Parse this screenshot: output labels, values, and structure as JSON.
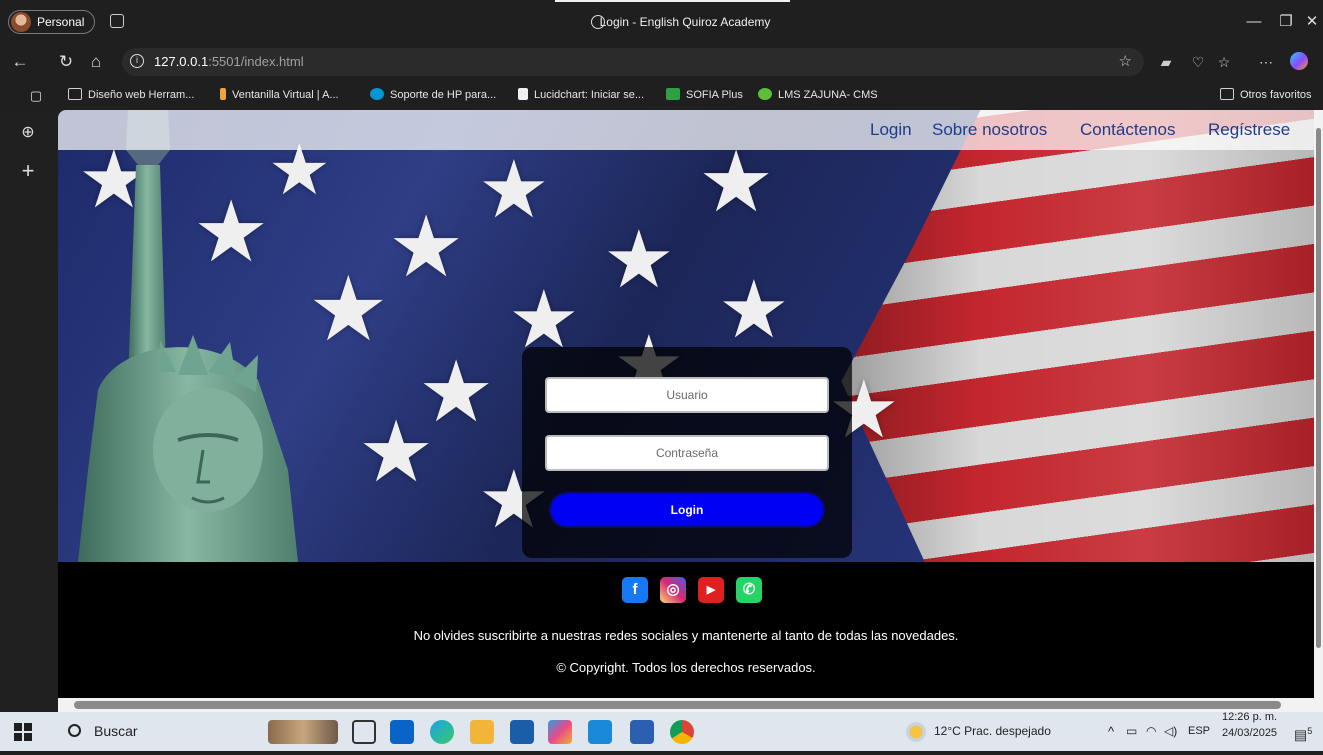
{
  "browser": {
    "profile_label": "Personal",
    "tab_title": "Login - English Quiroz Academy",
    "url_host": "127.0.0.1",
    "url_rest": ":5501/index.html",
    "favorites": [
      {
        "label": "Diseño web Herram...",
        "color": "#cfcfcf"
      },
      {
        "label": "Ventanilla Virtual | A...",
        "color": "#f2a33a"
      },
      {
        "label": "Soporte de HP para...",
        "color": "#0096d6"
      },
      {
        "label": "Lucidchart: Iniciar se...",
        "color": "#f0f0f0"
      },
      {
        "label": "SOFIA Plus",
        "color": "#2ea043"
      },
      {
        "label": "LMS ZAJUNA- CMS",
        "color": "#5bbf3a"
      }
    ],
    "other_favorites": "Otros favoritos"
  },
  "nav": {
    "links": [
      "Login",
      "Sobre nosotros",
      "Contáctenos",
      "Regístrese"
    ],
    "color": "#1d3c8a"
  },
  "login": {
    "username_placeholder": "Usuario",
    "password_placeholder": "Contraseña",
    "button_label": "Login",
    "button_color": "#0000f2"
  },
  "footer": {
    "social_icons": [
      {
        "name": "facebook-icon",
        "color": "#1877f2",
        "glyph": "f"
      },
      {
        "name": "instagram-icon",
        "color": "#d6249f",
        "glyph": "◎"
      },
      {
        "name": "youtube-icon",
        "color": "#e02020",
        "glyph": "▶"
      },
      {
        "name": "whatsapp-icon",
        "color": "#25d366",
        "glyph": "✆"
      }
    ],
    "subscribe_text": "No olvides suscribirte a nuestras redes sociales y mantenerte al tanto de todas las novedades.",
    "copyright_text": "© Copyright. Todos los derechos reservados."
  },
  "taskbar": {
    "search_label": "Buscar",
    "weather": "12°C  Prac. despejado",
    "language": "ESP",
    "time": "12:26 p. m.",
    "date": "24/03/2025",
    "notifications": "5"
  }
}
